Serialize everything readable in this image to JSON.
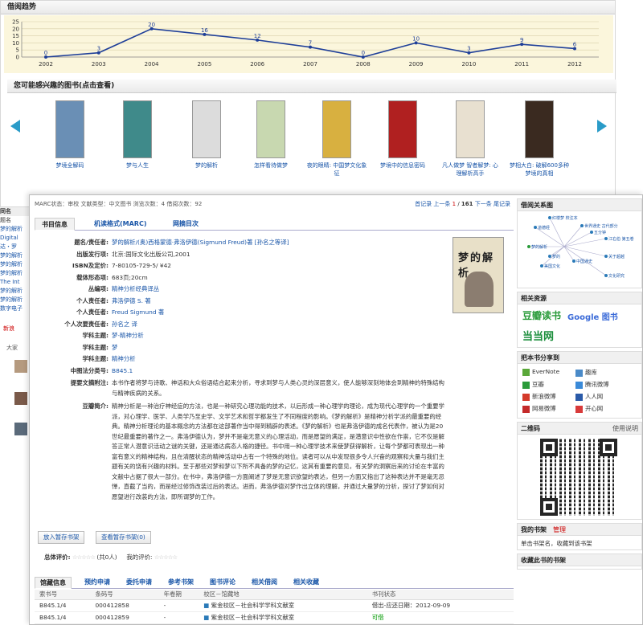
{
  "borrow_trend": {
    "title": "借阅趋势"
  },
  "chart_data": {
    "type": "line",
    "categories": [
      "2002",
      "2003",
      "2004",
      "2005",
      "2006",
      "2007",
      "2008",
      "2009",
      "2010",
      "2011",
      "2012"
    ],
    "values": [
      0,
      3,
      20,
      16,
      12,
      7,
      0,
      10,
      3,
      9,
      6
    ],
    "y_ticks": [
      0,
      5,
      10,
      15,
      20,
      25
    ],
    "ylim": [
      0,
      25
    ],
    "grid": true,
    "color": "#1f3f99"
  },
  "recommend": {
    "title": "您可能感兴趣的图书(点击查看)",
    "books": [
      {
        "title": "梦境全解码",
        "color": "#6a8fb5"
      },
      {
        "title": "梦与人生",
        "color": "#3f8a8a"
      },
      {
        "title": "梦的解析",
        "color": "#dcdcdc"
      },
      {
        "title": "怎样看待做梦",
        "color": "#c8d8b0"
      },
      {
        "title": "夜的眼睛: 中国梦文化象征",
        "color": "#d8b040"
      },
      {
        "title": "梦境中的信息密码",
        "color": "#b02020"
      },
      {
        "title": "凡人做梦 智者解梦: 心理解析高手",
        "color": "#e8e0d0"
      },
      {
        "title": "梦相大白: 破解600多种梦境的真相",
        "color": "#3a2a20"
      }
    ]
  },
  "left_peek": {
    "header": "同名",
    "items": [
      "题名",
      "梦的解析",
      "Digital",
      "达・罗",
      "梦的解析",
      "梦的解析",
      "梦的解析",
      "The Int",
      "梦的解析",
      "梦的解析",
      "数字电子"
    ],
    "sina": "新浪",
    "tab": "大家"
  },
  "record": {
    "status_line": "MARC状态：审校    文献类型：中文图书    浏览次数：4    借阅次数：92",
    "nav": {
      "first": "首记录",
      "prev": "上一条",
      "current": "1",
      "sep": "/",
      "total": "161",
      "next": "下一条",
      "last": "尾记录"
    },
    "tabs": [
      "书目信息",
      "机读格式(MARC)",
      "网摘目次"
    ],
    "fields": [
      {
        "label": "题名/责任者:",
        "value": "梦的解析/(奥)西格蒙德·弗洛伊德(Sigmund Freud)著 [孙名之等译]"
      },
      {
        "label": "出版发行项:",
        "value": "北京:国际文化出版公司,2001"
      },
      {
        "label": "ISBN及定价:",
        "value": "7-80105-729-5/ ¥42"
      },
      {
        "label": "载体形态项:",
        "value": "683页;20cm"
      },
      {
        "label": "丛编项:",
        "value": "精神分析经典译丛"
      },
      {
        "label": "个人责任者:",
        "value": "弗洛伊德 S. 著"
      },
      {
        "label": "个人责任者:",
        "value": "Freud Sigmund 著"
      },
      {
        "label": "个人次要责任者:",
        "value": "孙名之 译"
      },
      {
        "label": "学科主题:",
        "value": "梦-精神分析"
      },
      {
        "label": "学科主题:",
        "value": "梦"
      },
      {
        "label": "学科主题:",
        "value": "精神分析"
      },
      {
        "label": "中图法分类号:",
        "value": "B845.1"
      }
    ],
    "abstract_label": "提要文摘附注:",
    "abstract": "本书作者将梦与诗歌、神话和大众俗语结合起来分析，寻求到梦与人类心灵的深层意义，使人能够深刻地体会到精神的特殊结构与精神疾病的关系。",
    "douban_label": "豆瓣简介:",
    "douban": "精神分析是一种治疗神经症的方法，也是一种研究心理功能的技术，以后形成一种心理学的理论，成为现代心理学的一个重要学派，对心理学、医学、人类学乃至史学、文学艺术和哲学都发生了不同程度的影响。《梦的解析》是精神分析学派的最重要的经典。精神分析理论的基本概念的方法都在这部著作当中得到精辟的表述。《梦的解析》也是弗洛伊德的成名代表作，被认为是20世纪最重要的著作之一。弗洛伊德认为，梦并不是毫无意义的心理活动，而是愿望的满足，是潜意识中性欲在作祟，它不仅是解答正常人潜意识活动之谜的关键，还是通达病态人格的捷径。书中用一种心理学技术来使梦获得解析，让每个梦都可表现出一种富有意义的精神结构，且在清醒状态的精神活动中占有一个特殊的地位。读者可以从中发现很多令人兴奋的观察和大量与我们主题有关的饶有兴趣的材料。至于那些对梦和梦以下所不具备的梦的记忆，这其有重要的意见，有关梦的洞察后来的讨论在丰富的文献中占据了很大一部分。在书中，弗洛伊德一方面阐述了梦是无意识欲望的表达，但另一方面又指出了这种表达并不是毫无忌惮，直截了当的，而是经过修饰改装过后的表达。进而，弗洛伊德对梦作出立体的理解，并通过大量梦的分析，探讨了梦如何对愿望进行改装的方法，即所谓梦的工作。",
    "cover_title": "梦的解析",
    "buttons": {
      "add": "放入暂存书架",
      "view": "查看暂存书架(0)"
    },
    "rating_label": "总体评价:",
    "rating_count": "(共0人)",
    "my_rating_label": "我的评价:",
    "stars": "☆☆☆☆☆"
  },
  "holdings": {
    "tabs": [
      "馆藏信息",
      "预约申请",
      "委托申请",
      "参考书架",
      "图书评论",
      "相关借阅",
      "相关收藏"
    ],
    "columns": [
      "索书号",
      "条码号",
      "年卷期",
      "校区－馆藏地",
      "书刊状态"
    ],
    "rows": [
      {
        "call": "B845.1/4",
        "barcode": "000412858",
        "vol": "-",
        "loc": "紫金校区－社会科学学科文献室",
        "status": "借出-应还日期：2012-09-09"
      },
      {
        "call": "B845.1/4",
        "barcode": "000412859",
        "vol": "-",
        "loc": "紫金校区－社会科学学科文献室",
        "status": "可借"
      }
    ]
  },
  "sidebar": {
    "graph_title": "借阅关系图",
    "graph_nodes": [
      "红楼梦 校注本",
      "道德经",
      "世界通史 古代部分",
      "五分钟",
      "江右伯 第五卷",
      "梦的解析",
      "梦的",
      "美国文化",
      "中国通史",
      "关于超越",
      "文化研究"
    ],
    "resources_title": "相关资源",
    "douban_logo": "豆瓣读书",
    "google_logo": "Google 图书",
    "dangdang_logo": "当当网",
    "share_title": "把本书分享到",
    "share": [
      {
        "name": "EverNote",
        "color": "#5aa83a"
      },
      {
        "name": "豆瓣",
        "color": "#2a9b3a"
      },
      {
        "name": "新浪微博",
        "color": "#d43a2a"
      },
      {
        "name": "网易微博",
        "color": "#c42a2a"
      },
      {
        "name": "趣库",
        "color": "#4a8ac8"
      },
      {
        "name": "腾讯微博",
        "color": "#3a8ad8"
      },
      {
        "name": "人人网",
        "color": "#2a5aa8"
      },
      {
        "name": "开心网",
        "color": "#d83a3a"
      }
    ],
    "qr_title": "二维码",
    "qr_help": "使用说明",
    "myshelf_title": "我的书架",
    "myshelf_manage": "管理",
    "myshelf_hint": "单击书架名，收藏到该书架",
    "collect_title": "收藏此书的书架"
  }
}
